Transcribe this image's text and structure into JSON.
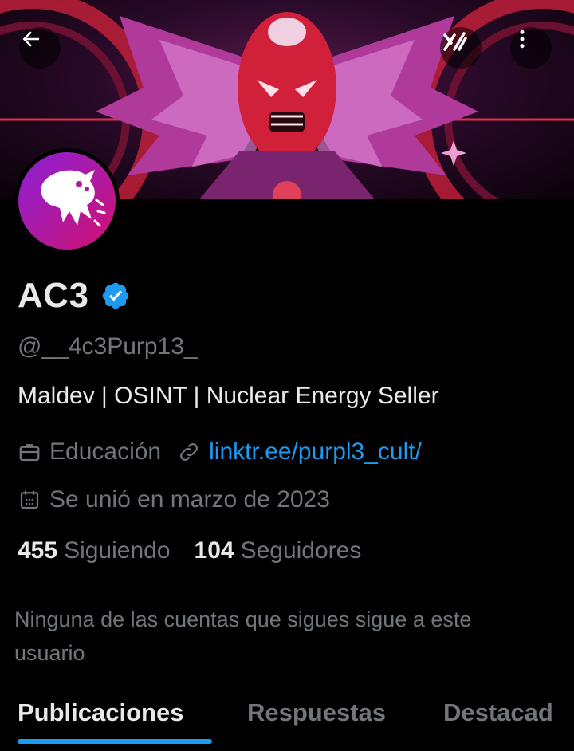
{
  "profile": {
    "display_name": "AC3",
    "handle": "@__4c3Purp13_",
    "bio": "Maldev | OSINT | Nuclear Energy Seller",
    "category": "Educación",
    "link": "linktr.ee/purpl3_cult/",
    "joined": "Se unió en marzo de 2023",
    "verified": true
  },
  "stats": {
    "following_count": "455",
    "following_label": "Siguiendo",
    "followers_count": "104",
    "followers_label": "Seguidores"
  },
  "followed_note": "Ninguna de las cuentas que sigues sigue a este usuario",
  "tabs": [
    {
      "label": "Publicaciones",
      "active": true
    },
    {
      "label": "Respuestas",
      "active": false
    },
    {
      "label": "Destacad",
      "active": false
    }
  ],
  "colors": {
    "accent": "#1d9bf0",
    "text": "#e7e9ea",
    "muted": "#71767b",
    "background": "#000000"
  },
  "icons": {
    "back": "arrow-left-icon",
    "grok": "grok-icon",
    "more": "more-vertical-icon",
    "category": "briefcase-icon",
    "link": "link-icon",
    "joined": "calendar-icon",
    "verified": "verified-badge-icon"
  }
}
